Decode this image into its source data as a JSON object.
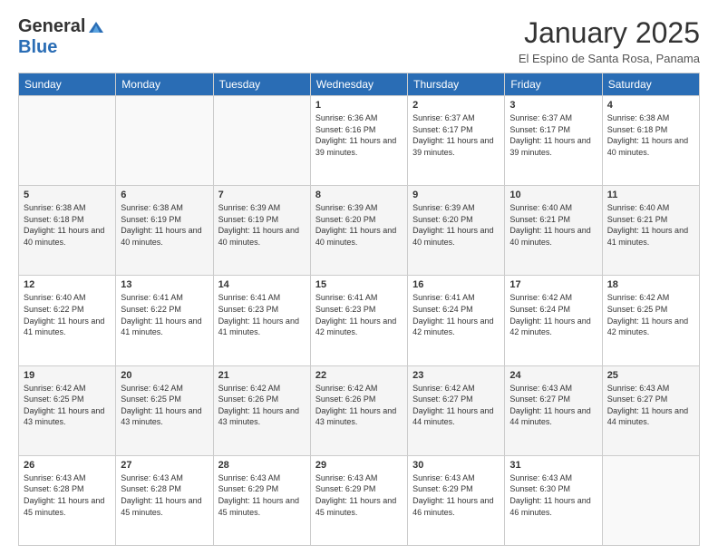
{
  "header": {
    "logo_general": "General",
    "logo_blue": "Blue",
    "month_title": "January 2025",
    "subtitle": "El Espino de Santa Rosa, Panama"
  },
  "days_of_week": [
    "Sunday",
    "Monday",
    "Tuesday",
    "Wednesday",
    "Thursday",
    "Friday",
    "Saturday"
  ],
  "weeks": [
    [
      {
        "day": "",
        "info": ""
      },
      {
        "day": "",
        "info": ""
      },
      {
        "day": "",
        "info": ""
      },
      {
        "day": "1",
        "info": "Sunrise: 6:36 AM\nSunset: 6:16 PM\nDaylight: 11 hours and 39 minutes."
      },
      {
        "day": "2",
        "info": "Sunrise: 6:37 AM\nSunset: 6:17 PM\nDaylight: 11 hours and 39 minutes."
      },
      {
        "day": "3",
        "info": "Sunrise: 6:37 AM\nSunset: 6:17 PM\nDaylight: 11 hours and 39 minutes."
      },
      {
        "day": "4",
        "info": "Sunrise: 6:38 AM\nSunset: 6:18 PM\nDaylight: 11 hours and 40 minutes."
      }
    ],
    [
      {
        "day": "5",
        "info": "Sunrise: 6:38 AM\nSunset: 6:18 PM\nDaylight: 11 hours and 40 minutes."
      },
      {
        "day": "6",
        "info": "Sunrise: 6:38 AM\nSunset: 6:19 PM\nDaylight: 11 hours and 40 minutes."
      },
      {
        "day": "7",
        "info": "Sunrise: 6:39 AM\nSunset: 6:19 PM\nDaylight: 11 hours and 40 minutes."
      },
      {
        "day": "8",
        "info": "Sunrise: 6:39 AM\nSunset: 6:20 PM\nDaylight: 11 hours and 40 minutes."
      },
      {
        "day": "9",
        "info": "Sunrise: 6:39 AM\nSunset: 6:20 PM\nDaylight: 11 hours and 40 minutes."
      },
      {
        "day": "10",
        "info": "Sunrise: 6:40 AM\nSunset: 6:21 PM\nDaylight: 11 hours and 40 minutes."
      },
      {
        "day": "11",
        "info": "Sunrise: 6:40 AM\nSunset: 6:21 PM\nDaylight: 11 hours and 41 minutes."
      }
    ],
    [
      {
        "day": "12",
        "info": "Sunrise: 6:40 AM\nSunset: 6:22 PM\nDaylight: 11 hours and 41 minutes."
      },
      {
        "day": "13",
        "info": "Sunrise: 6:41 AM\nSunset: 6:22 PM\nDaylight: 11 hours and 41 minutes."
      },
      {
        "day": "14",
        "info": "Sunrise: 6:41 AM\nSunset: 6:23 PM\nDaylight: 11 hours and 41 minutes."
      },
      {
        "day": "15",
        "info": "Sunrise: 6:41 AM\nSunset: 6:23 PM\nDaylight: 11 hours and 42 minutes."
      },
      {
        "day": "16",
        "info": "Sunrise: 6:41 AM\nSunset: 6:24 PM\nDaylight: 11 hours and 42 minutes."
      },
      {
        "day": "17",
        "info": "Sunrise: 6:42 AM\nSunset: 6:24 PM\nDaylight: 11 hours and 42 minutes."
      },
      {
        "day": "18",
        "info": "Sunrise: 6:42 AM\nSunset: 6:25 PM\nDaylight: 11 hours and 42 minutes."
      }
    ],
    [
      {
        "day": "19",
        "info": "Sunrise: 6:42 AM\nSunset: 6:25 PM\nDaylight: 11 hours and 43 minutes."
      },
      {
        "day": "20",
        "info": "Sunrise: 6:42 AM\nSunset: 6:25 PM\nDaylight: 11 hours and 43 minutes."
      },
      {
        "day": "21",
        "info": "Sunrise: 6:42 AM\nSunset: 6:26 PM\nDaylight: 11 hours and 43 minutes."
      },
      {
        "day": "22",
        "info": "Sunrise: 6:42 AM\nSunset: 6:26 PM\nDaylight: 11 hours and 43 minutes."
      },
      {
        "day": "23",
        "info": "Sunrise: 6:42 AM\nSunset: 6:27 PM\nDaylight: 11 hours and 44 minutes."
      },
      {
        "day": "24",
        "info": "Sunrise: 6:43 AM\nSunset: 6:27 PM\nDaylight: 11 hours and 44 minutes."
      },
      {
        "day": "25",
        "info": "Sunrise: 6:43 AM\nSunset: 6:27 PM\nDaylight: 11 hours and 44 minutes."
      }
    ],
    [
      {
        "day": "26",
        "info": "Sunrise: 6:43 AM\nSunset: 6:28 PM\nDaylight: 11 hours and 45 minutes."
      },
      {
        "day": "27",
        "info": "Sunrise: 6:43 AM\nSunset: 6:28 PM\nDaylight: 11 hours and 45 minutes."
      },
      {
        "day": "28",
        "info": "Sunrise: 6:43 AM\nSunset: 6:29 PM\nDaylight: 11 hours and 45 minutes."
      },
      {
        "day": "29",
        "info": "Sunrise: 6:43 AM\nSunset: 6:29 PM\nDaylight: 11 hours and 45 minutes."
      },
      {
        "day": "30",
        "info": "Sunrise: 6:43 AM\nSunset: 6:29 PM\nDaylight: 11 hours and 46 minutes."
      },
      {
        "day": "31",
        "info": "Sunrise: 6:43 AM\nSunset: 6:30 PM\nDaylight: 11 hours and 46 minutes."
      },
      {
        "day": "",
        "info": ""
      }
    ]
  ]
}
